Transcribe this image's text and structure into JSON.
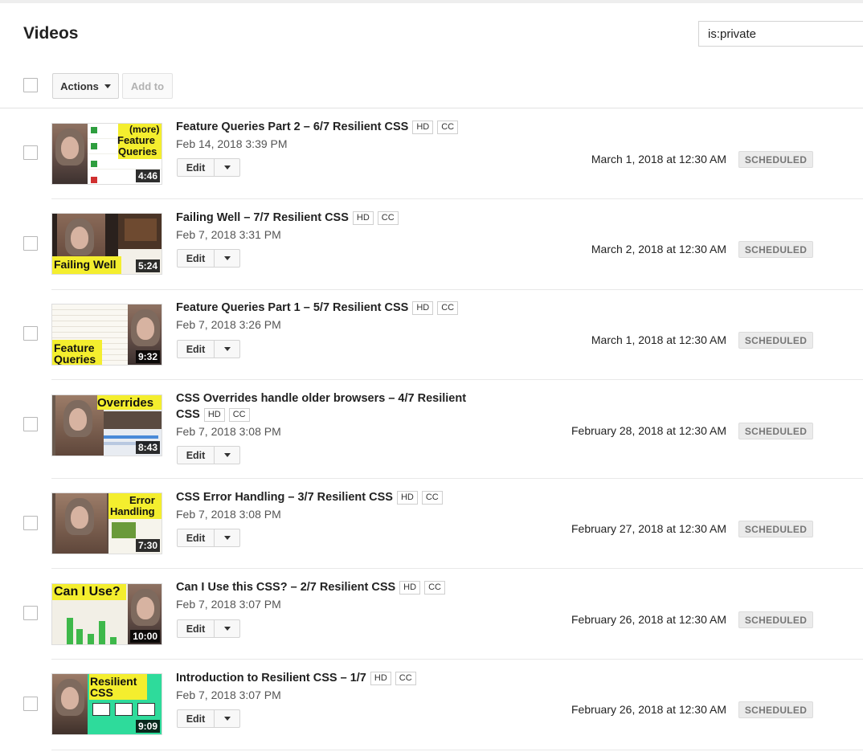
{
  "header": {
    "title": "Videos",
    "search_value": "is:private"
  },
  "toolbar": {
    "actions_label": "Actions",
    "add_to_label": "Add to"
  },
  "colors": {
    "badge_bg": "#ebebeb",
    "thumb_yellow": "#f4ee2e",
    "thumb_green": "#2edb9b"
  },
  "videos": [
    {
      "title": "Feature Queries Part 2 – 6/7 Resilient CSS",
      "hd": "HD",
      "cc": "CC",
      "uploaded": "Feb 14, 2018 3:39 PM",
      "duration": "4:46",
      "thumb_text": [
        "(more)",
        "Feature",
        "Queries"
      ],
      "scheduled": "March 1, 2018 at 12:30 AM",
      "status": "SCHEDULED",
      "edit_label": "Edit"
    },
    {
      "title": "Failing Well – 7/7 Resilient CSS",
      "hd": "HD",
      "cc": "CC",
      "uploaded": "Feb 7, 2018 3:31 PM",
      "duration": "5:24",
      "thumb_text": [
        "Failing Well"
      ],
      "scheduled": "March 2, 2018 at 12:30 AM",
      "status": "SCHEDULED",
      "edit_label": "Edit"
    },
    {
      "title": "Feature Queries Part 1 – 5/7 Resilient CSS",
      "hd": "HD",
      "cc": "CC",
      "uploaded": "Feb 7, 2018 3:26 PM",
      "duration": "9:32",
      "thumb_text": [
        "Feature",
        "Queries"
      ],
      "scheduled": "March 1, 2018 at 12:30 AM",
      "status": "SCHEDULED",
      "edit_label": "Edit"
    },
    {
      "title_line1": "CSS Overrides handle older browsers – 4/7 Resilient",
      "title_line2": "CSS",
      "hd": "HD",
      "cc": "CC",
      "uploaded": "Feb 7, 2018 3:08 PM",
      "duration": "8:43",
      "thumb_text": [
        "Overrides"
      ],
      "scheduled": "February 28, 2018 at 12:30 AM",
      "status": "SCHEDULED",
      "edit_label": "Edit"
    },
    {
      "title": "CSS Error Handling – 3/7 Resilient CSS",
      "hd": "HD",
      "cc": "CC",
      "uploaded": "Feb 7, 2018 3:08 PM",
      "duration": "7:30",
      "thumb_text": [
        "Error",
        "Handling"
      ],
      "scheduled": "February 27, 2018 at 12:30 AM",
      "status": "SCHEDULED",
      "edit_label": "Edit"
    },
    {
      "title": "Can I Use this CSS? – 2/7 Resilient CSS",
      "hd": "HD",
      "cc": "CC",
      "uploaded": "Feb 7, 2018 3:07 PM",
      "duration": "10:00",
      "thumb_text": [
        "Can I Use?"
      ],
      "scheduled": "February 26, 2018 at 12:30 AM",
      "status": "SCHEDULED",
      "edit_label": "Edit"
    },
    {
      "title": "Introduction to Resilient CSS – 1/7",
      "hd": "HD",
      "cc": "CC",
      "uploaded": "Feb 7, 2018 3:07 PM",
      "duration": "9:09",
      "thumb_text": [
        "Resilient",
        "CSS"
      ],
      "scheduled": "February 26, 2018 at 12:30 AM",
      "status": "SCHEDULED",
      "edit_label": "Edit"
    }
  ]
}
